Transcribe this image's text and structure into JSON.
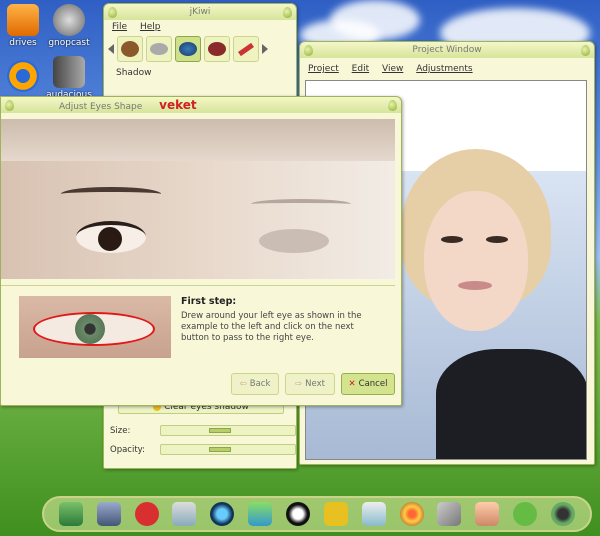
{
  "desktop": {
    "icons": [
      {
        "label": "drives"
      },
      {
        "label": "gnopcast"
      },
      {
        "label": "audacious"
      }
    ]
  },
  "jkiwi": {
    "title": "jKiwi",
    "menu": [
      "File",
      "Help"
    ],
    "section_label": "Shadow",
    "clear_button": "Clear eyes shadow",
    "size_label": "Size:",
    "opacity_label": "Opacity:"
  },
  "project_window": {
    "title": "Project Window",
    "menu": [
      "Project",
      "Edit",
      "View",
      "Adjustments"
    ]
  },
  "dialog": {
    "title": "Adjust Eyes Shape",
    "watermark": "veket",
    "step_title": "First step:",
    "step_text": "Drew around your left eye as shown in the example to the left and click on the next button to pass to the right eye.",
    "back_label": "Back",
    "next_label": "Next",
    "cancel_label": "Cancel"
  },
  "colors": {
    "panel": "#f8f8d8",
    "accent": "#d6e49a",
    "cancel_icon": "#d02020",
    "watermark": "#d02020"
  }
}
